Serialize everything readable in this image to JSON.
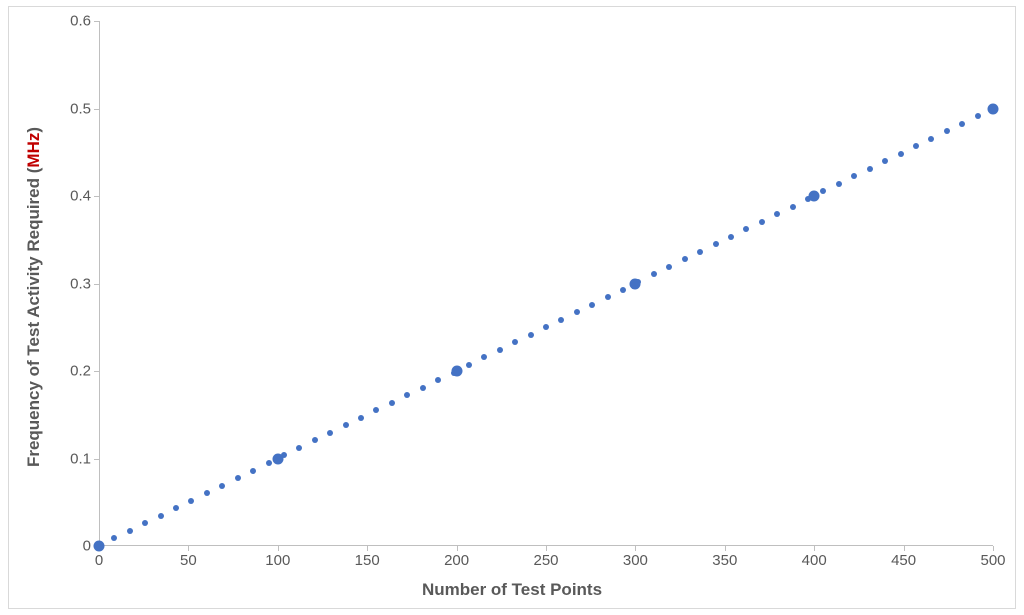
{
  "chart_data": {
    "type": "scatter",
    "x": [
      0,
      100,
      200,
      300,
      400,
      500
    ],
    "y": [
      0,
      0.1,
      0.2,
      0.3,
      0.4,
      0.5
    ],
    "trendline": {
      "type": "linear",
      "style": "dotted",
      "color": "#4472c4"
    },
    "xlabel": "Number of Test Points",
    "ylabel": "Frequency of Test Activity Required (MHz)",
    "xlim": [
      0,
      500
    ],
    "ylim": [
      0,
      0.6
    ],
    "xticks": [
      0,
      50,
      100,
      150,
      200,
      250,
      300,
      350,
      400,
      450,
      500
    ],
    "yticks": [
      0,
      0.1,
      0.2,
      0.3,
      0.4,
      0.5,
      0.6
    ]
  },
  "axis": {
    "ylabel_main": "Frequency of Test Activity Required (",
    "ylabel_unit": "MHz",
    "ylabel_close": ")",
    "xlabel": "Number of Test Points"
  },
  "colors": {
    "series": "#4472c4",
    "unit_highlight": "#c00000",
    "axis_text": "#595959",
    "axis_line": "#bfbfbf"
  }
}
